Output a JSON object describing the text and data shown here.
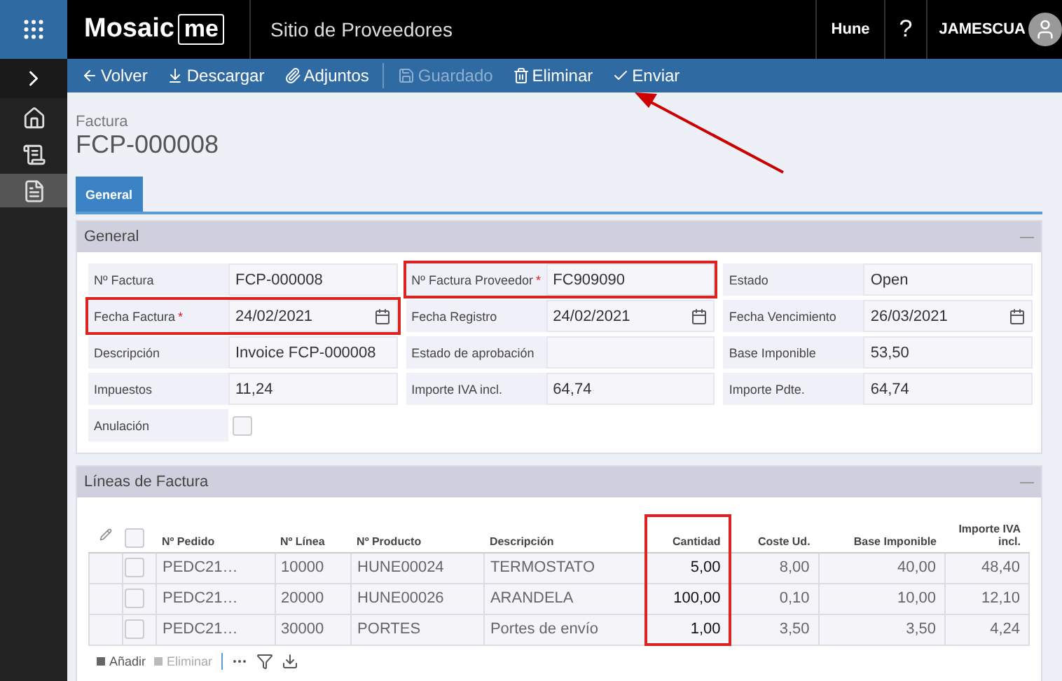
{
  "topbar": {
    "brand": "Mosaic",
    "brand_box": "me",
    "site": "Sitio de Proveedores",
    "company": "Hune",
    "help": "?",
    "user": "JAMESCUA"
  },
  "toolbar": [
    {
      "label": "Volver",
      "disabled": false,
      "highlighted": false
    },
    {
      "label": "Descargar",
      "disabled": false,
      "highlighted": false
    },
    {
      "label": "Adjuntos",
      "disabled": false,
      "highlighted": false
    },
    {
      "label": "Guardado",
      "disabled": true,
      "highlighted": false
    },
    {
      "label": "Eliminar",
      "disabled": false,
      "highlighted": false
    },
    {
      "label": "Enviar",
      "disabled": false,
      "highlighted": true
    }
  ],
  "sidebar": [
    {
      "selected": false
    },
    {
      "selected": false
    },
    {
      "selected": true
    }
  ],
  "header": {
    "type": "Factura",
    "number": "FCP-000008"
  },
  "tabs": [
    {
      "label": "General",
      "selected": true
    }
  ],
  "general": {
    "title": "General",
    "fields": [
      {
        "label": "Nº Factura",
        "value": "FCP-000008",
        "kind": "text",
        "highlighted": false
      },
      {
        "label": "Nº Factura Proveedor",
        "mark": "*",
        "value": "FC909090",
        "kind": "text",
        "highlighted": true
      },
      {
        "label": "Estado",
        "value": "Open",
        "kind": "text",
        "highlighted": false
      },
      {
        "label": "Fecha Factura",
        "mark": "*",
        "value": "24/02/2021",
        "kind": "date",
        "highlighted": true
      },
      {
        "label": "Fecha Registro",
        "value": "24/02/2021",
        "kind": "date",
        "highlighted": false
      },
      {
        "label": "Fecha Vencimiento",
        "value": "26/03/2021",
        "kind": "date",
        "highlighted": false
      },
      {
        "label": "Descripción",
        "value": "Invoice FCP-000008",
        "kind": "text",
        "highlighted": false
      },
      {
        "label": "Estado de aprobación",
        "kind": "text",
        "highlighted": false
      },
      {
        "label": "Base Imponible",
        "value": "53,50",
        "kind": "text",
        "highlighted": false
      },
      {
        "label": "Impuestos",
        "value": "11,24",
        "kind": "text",
        "highlighted": false
      },
      {
        "label": "Importe IVA incl.",
        "value": "64,74",
        "kind": "text",
        "highlighted": false
      },
      {
        "label": "Importe Pdte.",
        "value": "64,74",
        "kind": "text",
        "highlighted": false
      },
      {
        "label": "Anulación",
        "kind": "checkbox",
        "checked": false,
        "highlighted": false
      }
    ]
  },
  "lines": {
    "title": "Líneas de Factura",
    "select_all": {
      "checked": false
    },
    "columns": [
      {
        "label": "Nº Pedido",
        "highlighted": false
      },
      {
        "label": "Nº Línea",
        "highlighted": false
      },
      {
        "label": "Nº Producto",
        "highlighted": false
      },
      {
        "label": "Descripción",
        "highlighted": false
      },
      {
        "label": "Cantidad",
        "highlighted": true
      },
      {
        "label": "Coste Ud.",
        "highlighted": false
      },
      {
        "label": "Base Imponible",
        "highlighted": false
      },
      {
        "label": "Importe IVA incl.",
        "highlighted": false
      }
    ],
    "rows": [
      {
        "checked": false,
        "cells": [
          "PEDC21…",
          "10000",
          "HUNE00024",
          "TERMOSTATO",
          "5,00",
          "8,00",
          "40,00",
          "48,40"
        ]
      },
      {
        "checked": false,
        "cells": [
          "PEDC21…",
          "20000",
          "HUNE00026",
          "ARANDELA",
          "100,00",
          "0,10",
          "10,00",
          "12,10"
        ]
      },
      {
        "checked": false,
        "cells": [
          "PEDC21…",
          "30000",
          "PORTES",
          "Portes de envío",
          "1,00",
          "3,50",
          "3,50",
          "4,24"
        ]
      }
    ],
    "actions": [
      {
        "label": "Añadir",
        "disabled": false
      },
      {
        "label": "Eliminar",
        "disabled": true
      }
    ]
  }
}
